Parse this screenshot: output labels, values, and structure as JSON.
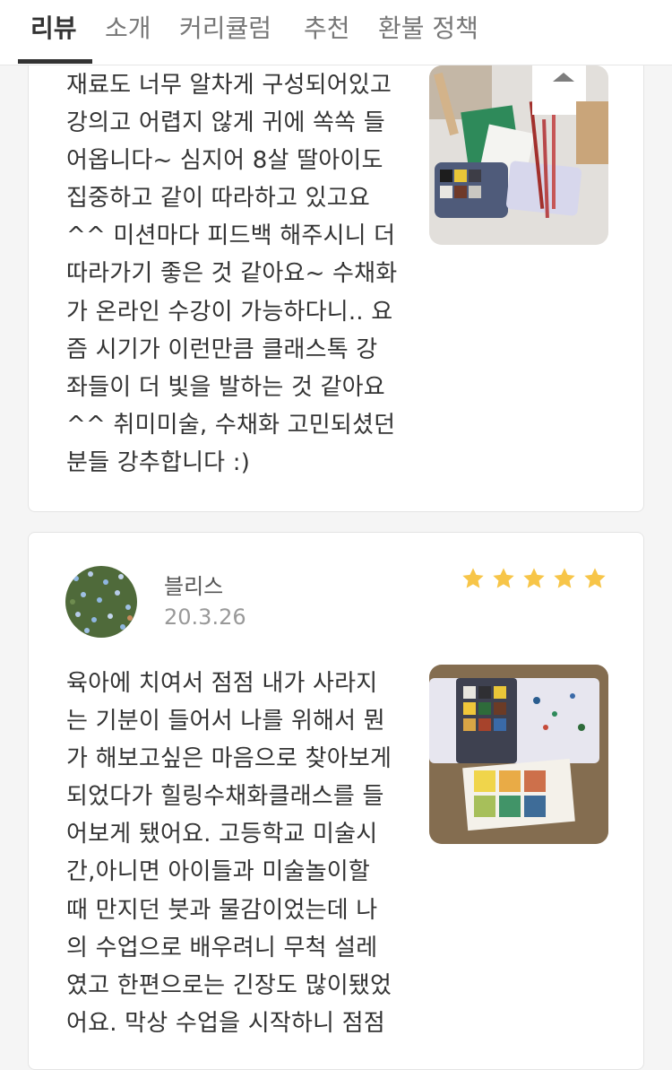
{
  "tabs": [
    {
      "label": "리뷰",
      "active": true
    },
    {
      "label": "소개",
      "active": false
    },
    {
      "label": "커리큘럼",
      "active": false
    },
    {
      "label": "추천",
      "active": false
    },
    {
      "label": "환불 정책",
      "active": false
    }
  ],
  "colors": {
    "accent": "#333333",
    "star": "#f7c548",
    "muted": "#999999"
  },
  "reviews": [
    {
      "text_lines": [
        "재료도 너무 알차게 구성되어있고",
        "강의고 어렵지 않게 귀에 쏙쏙 들",
        "어옵니다~ 심지어 8살 딸아이도",
        "집중하고 같이 따라하고 있고요",
        "^^ 미션마다 피드백 해주시니 더",
        "따라가기 좋은 것 같아요~ 수채화",
        "가 온라인 수강이 가능하다니.. 요",
        "즘 시기가 이런만큼 클래스톡 강",
        "좌들이 더 빛을 발하는 것 같아요",
        "^^ 취미미술, 수채화 고민되셨던",
        "분들 강추합니다 :)"
      ]
    },
    {
      "name": "블리스",
      "date": "20.3.26",
      "rating": 5,
      "text_lines": [
        "육아에 치여서 점점 내가 사라지",
        "는 기분이 들어서 나를 위해서 뭔",
        "가 해보고싶은 마음으로 찾아보게",
        "되었다가 힐링수채화클래스를 들",
        "어보게 됐어요. 고등학교 미술시",
        "간,아니면 아이들과 미술놀이할",
        "때 만지던 붓과 물감이었는데 나",
        "의 수업으로 배우려니 무척 설레",
        "였고 한편으로는 긴장도 많이됐었",
        "어요. 막상 수업을 시작하니 점점"
      ]
    }
  ]
}
